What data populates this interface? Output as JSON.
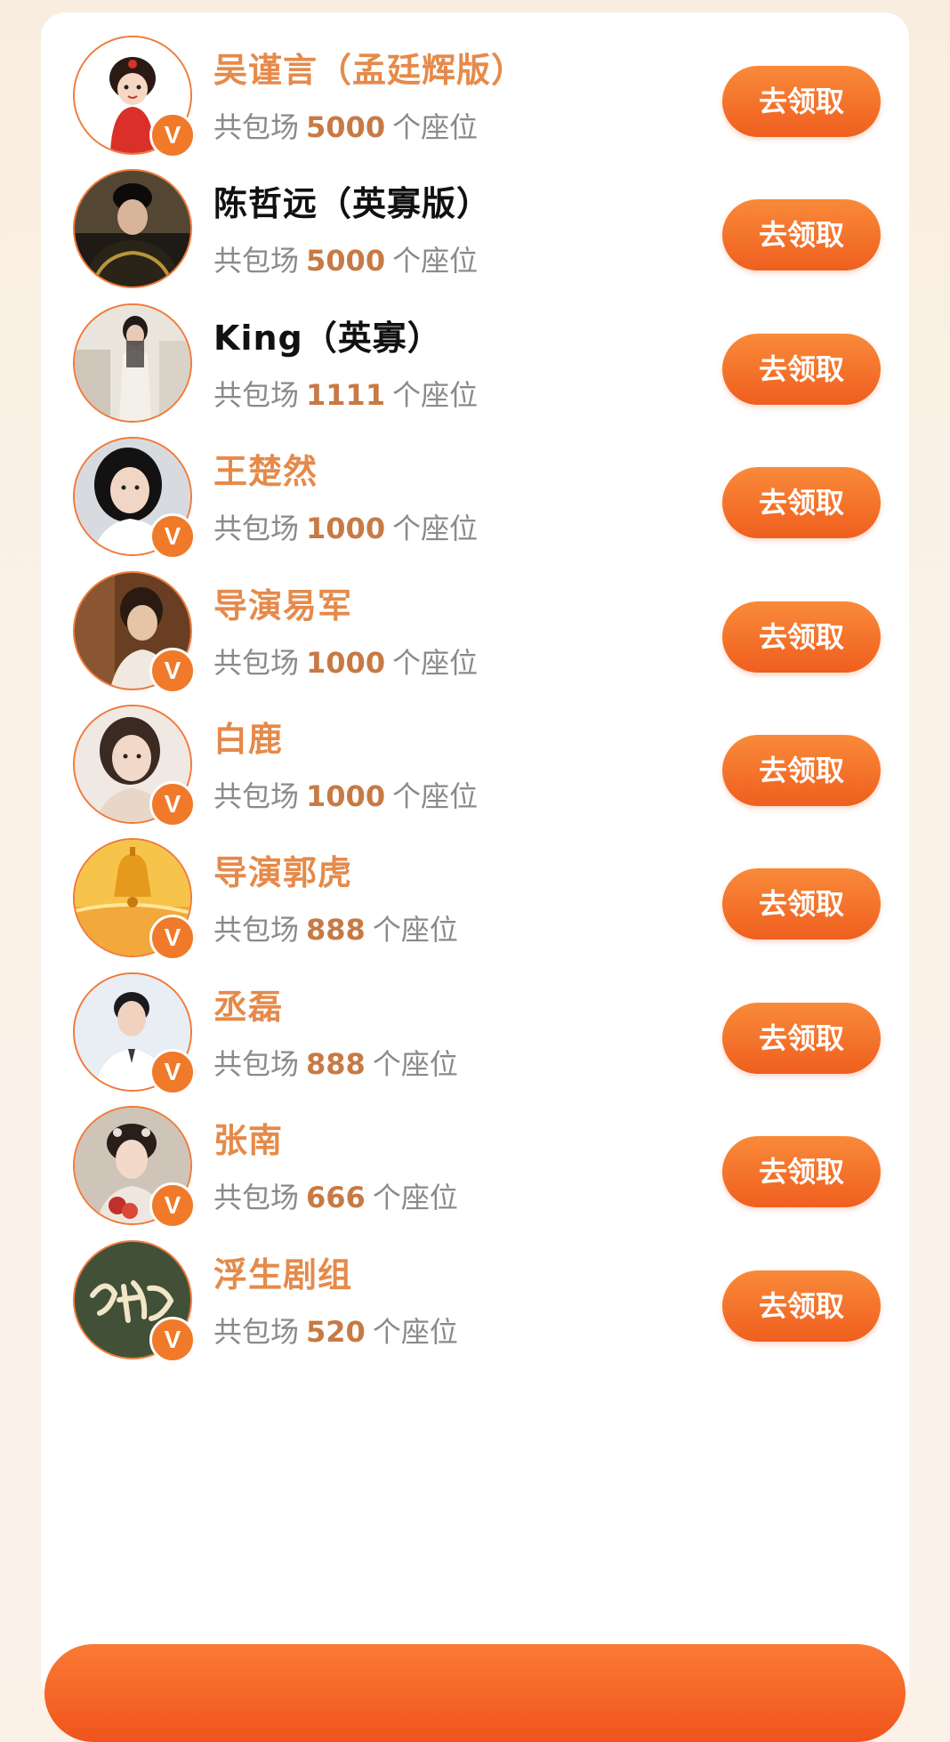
{
  "list": {
    "claim_label": "去领取",
    "badge_label": "V",
    "seats_prefix": "共包场",
    "seats_suffix": "个座位",
    "items": [
      {
        "name": "吴谨言（孟廷辉版）",
        "seats": "5000",
        "verified": true,
        "name_color": "orange",
        "avatar_icon": "cartoon-character-avatar-icon"
      },
      {
        "name": "陈哲远（英寡版）",
        "seats": "5000",
        "verified": false,
        "name_color": "black",
        "avatar_icon": "person-photo-avatar-icon"
      },
      {
        "name": "King（英寡）",
        "seats": "1111",
        "verified": false,
        "name_color": "black",
        "avatar_icon": "person-photo-avatar-icon"
      },
      {
        "name": "王楚然",
        "seats": "1000",
        "verified": true,
        "name_color": "orange",
        "avatar_icon": "person-photo-avatar-icon"
      },
      {
        "name": "导演易军",
        "seats": "1000",
        "verified": true,
        "name_color": "orange",
        "avatar_icon": "person-photo-avatar-icon"
      },
      {
        "name": "白鹿",
        "seats": "1000",
        "verified": true,
        "name_color": "orange",
        "avatar_icon": "person-photo-avatar-icon"
      },
      {
        "name": "导演郭虎",
        "seats": "888",
        "verified": true,
        "name_color": "orange",
        "avatar_icon": "bell-landscape-avatar-icon"
      },
      {
        "name": "丞磊",
        "seats": "888",
        "verified": true,
        "name_color": "orange",
        "avatar_icon": "person-photo-avatar-icon"
      },
      {
        "name": "张南",
        "seats": "666",
        "verified": true,
        "name_color": "orange",
        "avatar_icon": "person-photo-avatar-icon"
      },
      {
        "name": "浮生剧组",
        "seats": "520",
        "verified": true,
        "name_color": "orange",
        "avatar_icon": "calligraphy-logo-avatar-icon"
      }
    ]
  },
  "colors": {
    "accent": "#f07a2a",
    "button_top": "#f98a3a",
    "button_bottom": "#ef5f1f",
    "name_orange": "#e58a4a",
    "seat_number": "#c77a45",
    "muted_text": "#8a8a8a",
    "page_bg": "#fbf1e6"
  }
}
